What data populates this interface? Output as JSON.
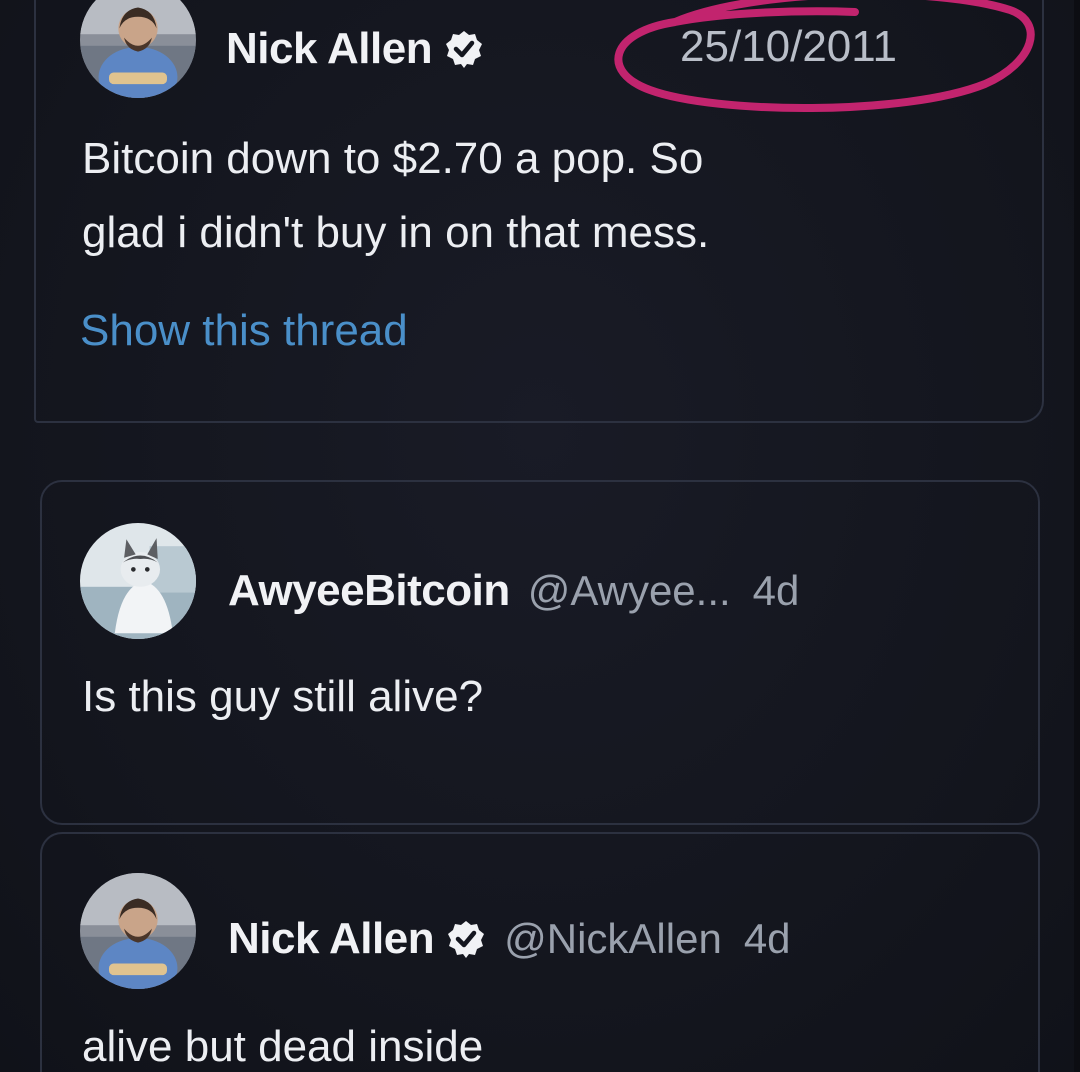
{
  "tweet_original": {
    "display_name": "Nick Allen",
    "date": "25/10/2011",
    "text_line_1": "Bitcoin down to $2.70 a pop. So",
    "text_line_2": "glad i didn't buy in on that mess.",
    "thread_link": "Show this thread"
  },
  "reply_1": {
    "display_name": "AwyeeBitcoin",
    "handle": "@Awyee...",
    "time": "4d",
    "text": "Is this guy still alive?"
  },
  "reply_2": {
    "display_name": "Nick Allen",
    "handle": "@NickAllen",
    "time": "4d",
    "text": "alive but dead inside"
  },
  "colors": {
    "background": "#14161f",
    "card_border": "#2c3140",
    "link_blue": "#4a8fc9",
    "circle_magenta": "#c2246e",
    "muted_text": "#9aa1ad"
  },
  "icons": {
    "verified": "verified-badge-icon",
    "circle": "hand-drawn-circle-annotation"
  }
}
